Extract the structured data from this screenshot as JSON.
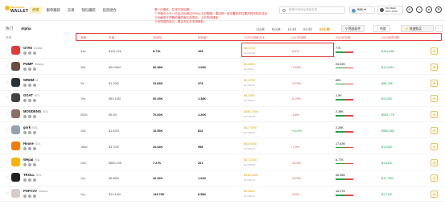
{
  "brand": {
    "top": "Meme Book",
    "name": "WALLET"
  },
  "nav": [
    "代币",
    "跟单跟踪",
    "交易",
    "钱包跟踪",
    "投资组合"
  ],
  "notice": [
    "第一行最红，并且字体加粗",
    "①市值中小于一亿且占比超过30%以上的数据，建议统一放在醒目的位置并同步标红突出",
    "②价格低于同期价格的用红色显示，上升的用绿色",
    "③未完成的定义，建议不区分字体颜色"
  ],
  "search": {
    "placeholder": "搜索代币地址或者名称"
  },
  "chain": "SOL",
  "wallet": {
    "line1": "My Wallet",
    "line2": "0x3f...b21d"
  },
  "top_icons": [
    "globe-icon",
    "bell-icon",
    "user-icon",
    "settings-icon"
  ],
  "tabs": [
    "热门",
    "Alpha"
  ],
  "timeframes": [
    "1分钟",
    "5分钟",
    "1小时",
    "6小时",
    "24小时"
  ],
  "buttons": {
    "filter": "筛选条件",
    "sort": "热度",
    "quick": "快速购买"
  },
  "columns": [
    "代币",
    "池龄",
    "市值",
    "流动性",
    "持有者",
    "TOP10持有占比",
    "价格",
    "24小时涨跌",
    "24小时交易",
    "24小时成交额"
  ],
  "rows": [
    {
      "name": "GTA6",
      "tag": "Solana",
      "avatar": "#e53935",
      "age": "31d",
      "mcap": "$121.42k",
      "liq": "8.71k",
      "holders": "433",
      "top10": "12.7%",
      "price": "$0.2733",
      "price_sub": "$0.000008",
      "change": "-5.4%",
      "dir": "down",
      "tx": "775",
      "tx_sub": "370/405",
      "buy_ratio": 0.48,
      "vol": "$101.68k"
    },
    {
      "name": "PUMP",
      "tag": "Solana",
      "avatar": "#6d4c41",
      "age": "39d",
      "mcap": "$54.56M",
      "liq": "66.38K",
      "holders": "1.09K",
      "top10": "22.3%",
      "price": "$1.4600",
      "price_sub": "$0.00002",
      "change": "-7.63%",
      "dir": "down",
      "tx": "26.39K",
      "tx_sub": "13.1k/13.2k",
      "buy_ratio": 0.5,
      "vol": "$12.04M"
    },
    {
      "name": "WRHM",
      "tag": "M",
      "avatar": "#263238",
      "age": "2d",
      "mcap": "$1.20M",
      "liq": "23.68K",
      "holders": "374",
      "top10": "15.5%",
      "price": "$2.0730",
      "price_sub": "$0.000012",
      "change": "-10.5%",
      "dir": "down",
      "tx": "895",
      "tx_sub": "453/442",
      "buy_ratio": 0.51,
      "vol": "$96.19K"
    },
    {
      "name": "GOAT",
      "tag": "SOL",
      "avatar": "#424242",
      "age": "19d",
      "mcap": "$84.15M",
      "liq": "60.25K",
      "holders": "1.38K",
      "top10": "14.8%",
      "price": "$9.1000",
      "price_sub": "$0.000007",
      "change": "-5.25%",
      "dir": "down",
      "tx": "1.5K",
      "tx_sub": "761/739",
      "buy_ratio": 0.51,
      "vol": "$3.02M"
    },
    {
      "name": "MOODENG",
      "tag": "SOL",
      "avatar": "#8d6e63",
      "age": "300d",
      "mcap": "$5.4B",
      "liq": "70.00K",
      "holders": "1.20K",
      "top10": "11.2%",
      "price": "$184.2000",
      "price_sub": "$0.000020",
      "change": "-1.8%",
      "dir": "down",
      "tx": "2.38K",
      "tx_sub": "1.2k/1.18k",
      "buy_ratio": 0.5,
      "vol": "$945.77K"
    },
    {
      "name": "gork",
      "tag": "SOL",
      "avatar": "#90a4ae",
      "age": "10d",
      "mcap": "$1.62M",
      "liq": "16.55K",
      "holders": "812",
      "top10": "21.4%",
      "price": "$12.7500",
      "price_sub": "$0.000016",
      "change": "+10.2%",
      "dir": "up",
      "tx": "2.28K",
      "tx_sub": "1.1k/1.18k",
      "buy_ratio": 0.48,
      "vol": "$985.38K"
    },
    {
      "name": "House",
      "tag": "SOL",
      "avatar": "#f57c00",
      "age": "168d",
      "mcap": "$3.70M",
      "liq": "24.44K",
      "holders": "998",
      "top10": "18.9%",
      "price": "$64.0000",
      "price_sub": "$0.000011",
      "change": "-7.9%",
      "dir": "down",
      "tx": "17.63K",
      "tx_sub": "8.8k/8.8k",
      "buy_ratio": 0.5,
      "vol": "$1.22M"
    },
    {
      "name": "Wepai",
      "tag": "SOL",
      "avatar": "#ffb300",
      "age": "12m",
      "mcap": "$889.13K",
      "liq": "7.27K",
      "holders": "261",
      "top10": "33.1%",
      "price": "$37.2200",
      "price_sub": "$0.000009",
      "change": "-14.5%",
      "dir": "down",
      "tx": "6.77K",
      "tx_sub": "3.3k/3.4k",
      "buy_ratio": 0.49,
      "vol": "$1.91M"
    },
    {
      "name": "TROLL",
      "tag": "SOL",
      "avatar": "#212121",
      "age": "11y",
      "mcap": "$6.88M",
      "liq": "42.32K",
      "holders": "1.02K",
      "top10": "16.2%",
      "price": "$136.0000",
      "price_sub": "$0.000013",
      "change": "-10.5%",
      "dir": "down",
      "tx": "46.38K",
      "tx_sub": "23.1k/23.2k",
      "buy_ratio": 0.5,
      "vol": "$11.79M"
    },
    {
      "name": "POPCAT",
      "tag": "Solana",
      "avatar": "#d7ccc8",
      "age": "11y",
      "mcap": "$13.44M",
      "liq": "143.75K",
      "holders": "6.58K",
      "top10": "9.8%",
      "price": "$0.9600",
      "price_sub": "$0.000014",
      "change": "-3.6%",
      "dir": "down",
      "tx": "16.27K",
      "tx_sub": "8.1k/8.1k",
      "buy_ratio": 0.5,
      "vol": "$1.71M"
    }
  ]
}
